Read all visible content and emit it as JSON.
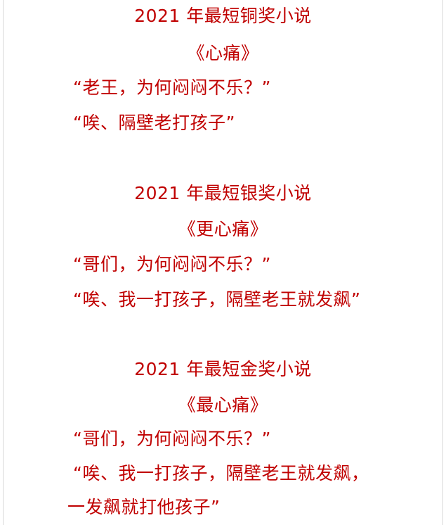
{
  "stories": [
    {
      "title": "2021 年最短铜奖小说",
      "subtitle": "《心痛》",
      "lines": [
        "“老王，为何闷闷不乐？”",
        "“唉、隔壁老打孩子”"
      ]
    },
    {
      "title": "2021 年最短银奖小说",
      "subtitle": "《更心痛》",
      "lines": [
        "“哥们，为何闷闷不乐？”",
        "“唉、我一打孩子，隔壁老王就发飙”"
      ]
    },
    {
      "title": "2021 年最短金奖小说",
      "subtitle": "《最心痛》",
      "lines": [
        "“哥们，为何闷闷不乐？”",
        "“唉、我一打孩子，隔壁老王就发飙，",
        "一发飙就打他孩子”"
      ]
    }
  ],
  "text_color": "#c00000"
}
